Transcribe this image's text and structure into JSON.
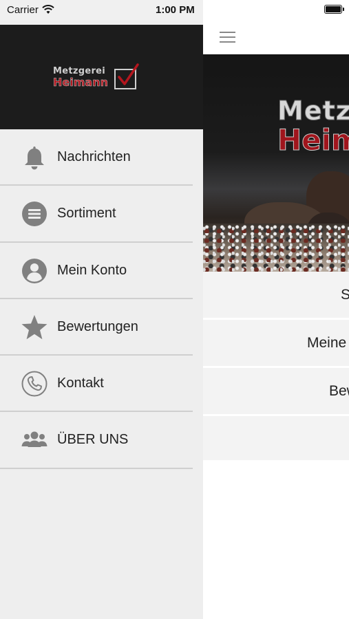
{
  "status_bar": {
    "carrier": "Carrier",
    "time": "1:00 PM"
  },
  "drawer": {
    "logo": {
      "line1": "Metzgerei",
      "line2": "Heimann"
    },
    "items": [
      {
        "label": "Nachrichten",
        "icon": "bell-icon"
      },
      {
        "label": "Sortiment",
        "icon": "list-circle-icon"
      },
      {
        "label": "Mein Konto",
        "icon": "user-circle-icon"
      },
      {
        "label": "Bewertungen",
        "icon": "star-icon"
      },
      {
        "label": "Kontakt",
        "icon": "phone-icon"
      },
      {
        "label": "ÜBER UNS",
        "icon": "group-icon"
      }
    ]
  },
  "main": {
    "hero": {
      "title_line1": "Metzgerei",
      "title_line2": "Heimann"
    },
    "rows": [
      {
        "label": "Sortiment"
      },
      {
        "label": "Meine"
      },
      {
        "label": "Bewertungen"
      }
    ]
  },
  "colors": {
    "brand_red": "#b3161e",
    "drawer_bg": "#eeeeee",
    "header_bg": "#1c1c1c",
    "icon_gray": "#808080"
  }
}
